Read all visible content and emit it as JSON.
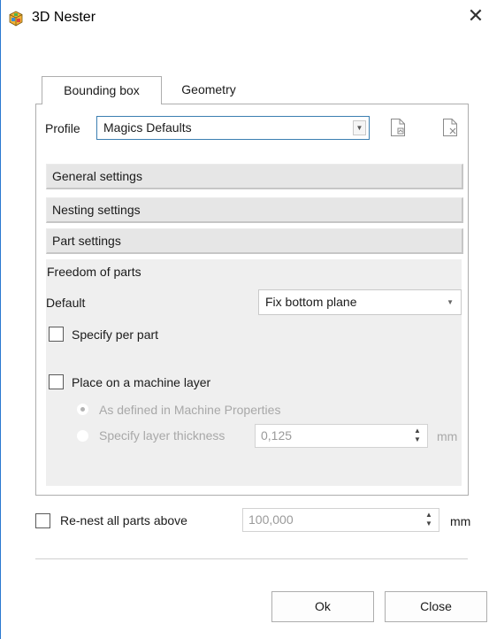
{
  "window": {
    "title": "3D Nester",
    "icon": "nester-app-icon",
    "close_icon": "close-icon"
  },
  "tabs": [
    {
      "label": "Bounding box",
      "active": true
    },
    {
      "label": "Geometry",
      "active": false
    }
  ],
  "profile": {
    "label": "Profile",
    "value": "Magics Defaults",
    "new_icon": "new-profile-icon",
    "delete_icon": "delete-profile-icon"
  },
  "sections": {
    "general": "General settings",
    "nesting": "Nesting settings",
    "part": "Part settings"
  },
  "part_settings": {
    "freedom_heading": "Freedom of parts",
    "default_label": "Default",
    "default_value": "Fix bottom plane",
    "specify_per_part": {
      "label": "Specify per part",
      "checked": false
    },
    "machine_layer": {
      "label": "Place on a machine layer",
      "checked": false
    },
    "as_defined": {
      "label": "As defined in Machine Properties",
      "selected": true,
      "enabled": false
    },
    "specify_thickness": {
      "label": "Specify layer thickness",
      "selected": false,
      "enabled": false
    },
    "thickness_value": "0,125",
    "thickness_unit": "mm"
  },
  "renest": {
    "label": "Re-nest all parts above",
    "checked": false,
    "value": "100,000",
    "unit": "mm"
  },
  "buttons": {
    "ok": "Ok",
    "close": "Close"
  },
  "colors": {
    "accent_border": "#2b79d0",
    "select_focus": "#3c7fb1",
    "section_bg": "#e6e6e6",
    "panel_bg": "#efefef"
  }
}
